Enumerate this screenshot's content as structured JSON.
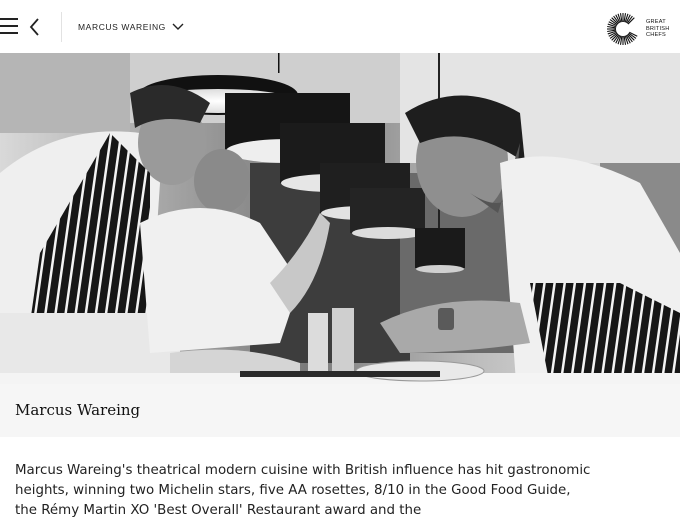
{
  "header": {
    "section_label": "MARCUS WAREING",
    "logo_text": [
      "GREAT",
      "BRITISH",
      "CHEFS"
    ]
  },
  "hero": {
    "image_description": "Black and white photo of chefs plating food under pendant lamps"
  },
  "chef": {
    "name": "Marcus Wareing",
    "description": "Marcus Wareing's theatrical modern cuisine with British influence has hit gastronomic heights, winning two Michelin stars, five AA rosettes, 8/10 in the Good Food Guide, the Rémy Martin XO 'Best Overall' Restaurant award and the"
  },
  "icons": {
    "menu": "hamburger-menu-icon",
    "back": "chevron-left-icon",
    "dropdown": "chevron-down-icon",
    "logo": "sunburst-logo-icon"
  }
}
